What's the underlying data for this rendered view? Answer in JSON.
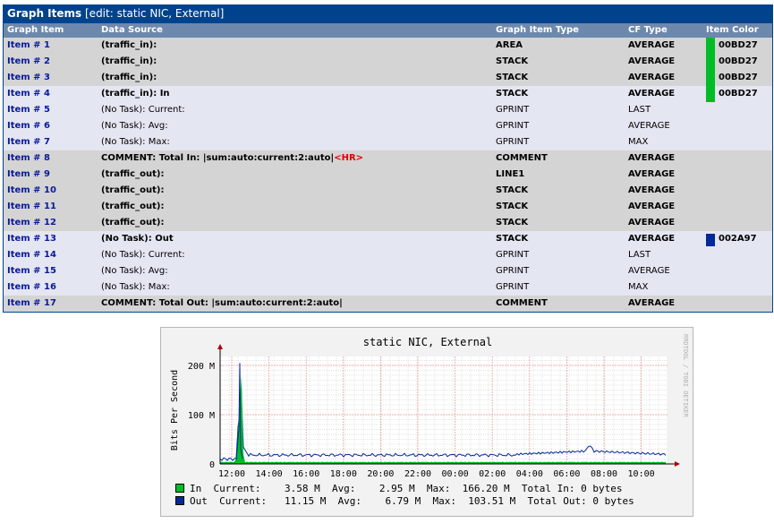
{
  "panel": {
    "title": "Graph Items",
    "subtitle": "[edit: static NIC, External]"
  },
  "columns": {
    "item": "Graph Item",
    "source": "Data Source",
    "type": "Graph Item Type",
    "cf": "CF Type",
    "color": "Item Color"
  },
  "rows": [
    {
      "label": "Item # 1",
      "source": "(traffic_in):",
      "type": "AREA",
      "cf": "AVERAGE",
      "color": "00BD27"
    },
    {
      "label": "Item # 2",
      "source": "(traffic_in):",
      "type": "STACK",
      "cf": "AVERAGE",
      "color": "00BD27"
    },
    {
      "label": "Item # 3",
      "source": "(traffic_in):",
      "type": "STACK",
      "cf": "AVERAGE",
      "color": "00BD27"
    },
    {
      "label": "Item # 4",
      "source": "(traffic_in): In",
      "type": "STACK",
      "cf": "AVERAGE",
      "color": "00BD27"
    },
    {
      "label": "Item # 5",
      "source": "(No Task): Current:",
      "type": "GPRINT",
      "cf": "LAST",
      "color": ""
    },
    {
      "label": "Item # 6",
      "source": "(No Task): Avg:",
      "type": "GPRINT",
      "cf": "AVERAGE",
      "color": ""
    },
    {
      "label": "Item # 7",
      "source": "(No Task): Max:",
      "type": "GPRINT",
      "cf": "MAX",
      "color": ""
    },
    {
      "label": "Item # 8",
      "source": "COMMENT: Total In: |sum:auto:current:2:auto|",
      "source_tag": "<HR>",
      "type": "COMMENT",
      "cf": "AVERAGE",
      "color": ""
    },
    {
      "label": "Item # 9",
      "source": "(traffic_out):",
      "type": "LINE1",
      "cf": "AVERAGE",
      "color": ""
    },
    {
      "label": "Item # 10",
      "source": "(traffic_out):",
      "type": "STACK",
      "cf": "AVERAGE",
      "color": ""
    },
    {
      "label": "Item # 11",
      "source": "(traffic_out):",
      "type": "STACK",
      "cf": "AVERAGE",
      "color": ""
    },
    {
      "label": "Item # 12",
      "source": "(traffic_out):",
      "type": "STACK",
      "cf": "AVERAGE",
      "color": ""
    },
    {
      "label": "Item # 13",
      "source": "(No Task): Out",
      "type": "STACK",
      "cf": "AVERAGE",
      "color": "002A97"
    },
    {
      "label": "Item # 14",
      "source": "(No Task): Current:",
      "type": "GPRINT",
      "cf": "LAST",
      "color": ""
    },
    {
      "label": "Item # 15",
      "source": "(No Task): Avg:",
      "type": "GPRINT",
      "cf": "AVERAGE",
      "color": ""
    },
    {
      "label": "Item # 16",
      "source": "(No Task): Max:",
      "type": "GPRINT",
      "cf": "MAX",
      "color": ""
    },
    {
      "label": "Item # 17",
      "source": "COMMENT: Total Out: |sum:auto:current:2:auto|",
      "type": "COMMENT",
      "cf": "AVERAGE",
      "color": ""
    }
  ],
  "graph": {
    "title": "static NIC, External",
    "ylabel": "Bits Per Second",
    "watermark": "RRDTOOL / TOBI OETIKER",
    "y_ticks": [
      "0",
      "100 M",
      "200 M"
    ],
    "x_ticks": [
      "12:00",
      "14:00",
      "16:00",
      "18:00",
      "20:00",
      "22:00",
      "00:00",
      "02:00",
      "04:00",
      "06:00",
      "08:00",
      "10:00"
    ],
    "in_color": "#00BD27",
    "out_color": "#002A97",
    "legend_in": "In  Current:    3.58 M  Avg:    2.95 M  Max:  166.20 M  Total In: 0 bytes",
    "legend_out": "Out  Current:   11.15 M  Avg:    6.79 M  Max:  103.51 M  Total Out: 0 bytes"
  }
}
